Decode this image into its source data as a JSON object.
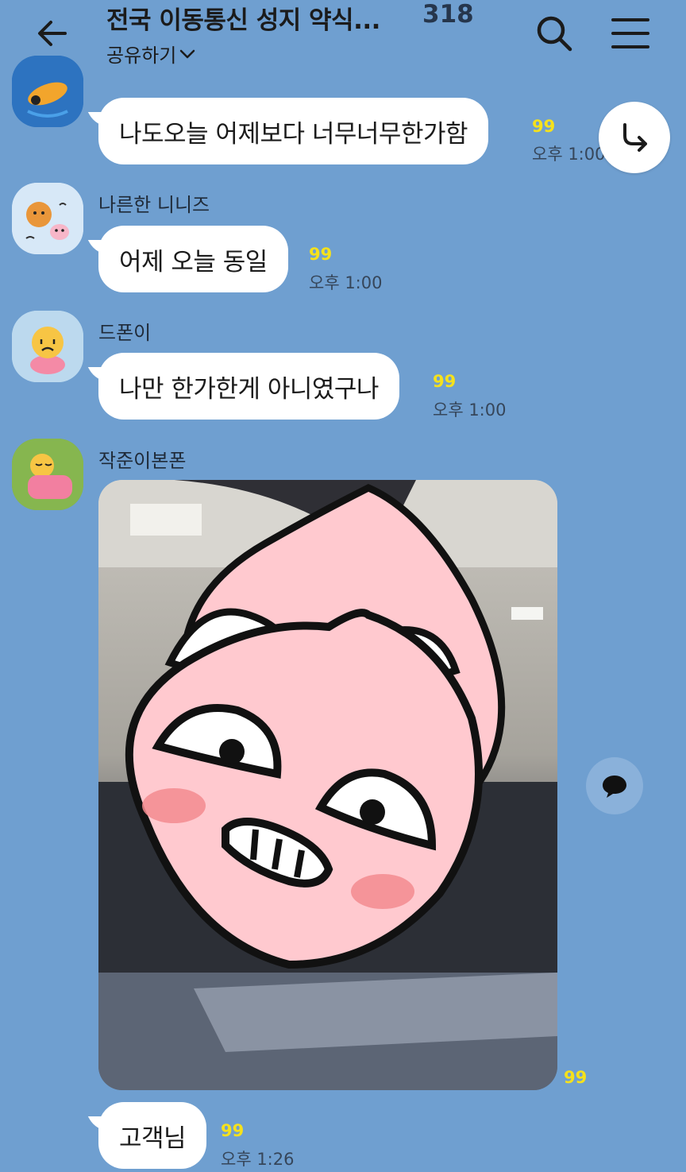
{
  "header": {
    "title": "전국 이동통신 성지 약식...",
    "member_count": "318",
    "share_label": "공유하기"
  },
  "icons": {
    "back": "back-arrow-icon",
    "search": "search-icon",
    "menu": "hamburger-menu-icon",
    "forward": "forward-share-icon",
    "comment": "comment-bubble-icon",
    "share_dropdown": "chevron-down-icon"
  },
  "colors": {
    "background": "#6f9fd0",
    "bubble": "#ffffff",
    "unread": "#f5e11c",
    "peach": "#ffc9cf"
  },
  "messages": [
    {
      "sender": "",
      "text": "나도오늘 어제보다 너무너무한가함",
      "unread": "99",
      "time": "오후 1:00"
    },
    {
      "sender": "나른한 니니즈",
      "text": "어제 오늘 동일",
      "unread": "99",
      "time": "오후 1:00"
    },
    {
      "sender": "드폰이",
      "text": "나만 한가한게 아니였구나",
      "unread": "99",
      "time": "오후 1:00"
    },
    {
      "sender": "작준이본폰",
      "type": "photo",
      "unread": "99"
    },
    {
      "sender": "",
      "text": "고객님",
      "unread": "99",
      "time": "오후 1:26"
    }
  ]
}
